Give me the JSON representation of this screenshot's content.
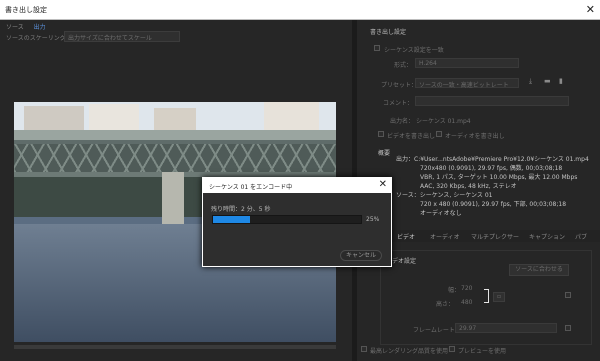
{
  "window": {
    "title": "書き出し設定",
    "close": "✕"
  },
  "left": {
    "tabs": [
      "ソース",
      "出力"
    ],
    "scaling_label": "ソースのスケーリング：",
    "scaling_value": "出力サイズに合わせてスケール"
  },
  "right": {
    "section_title": "書き出し設定",
    "match_sequence": "シーケンス設定を一致",
    "format_label": "形式：",
    "format_value": "H.264",
    "preset_label": "プリセット：",
    "preset_value": "ソースの一致・高速ビットレート",
    "comment_label": "コメント：",
    "output_label": "出力名：",
    "output_value": "シーケンス 01.mp4",
    "export_video": "ビデオを書き出し",
    "export_audio": "オーディオを書き出し",
    "summary_title": "概要",
    "summary": {
      "output_label": "出力：",
      "output_lines": [
        "C:¥User...ntsAdobe¥Premiere Pro¥12.0¥シーケンス 01.mp4",
        "720x480 (0.9091), 29.97 fps, 偶数, 00;03;08;18",
        "VBR, 1 パス, ターゲット 10.00 Mbps, 最大 12.00 Mbps",
        "AAC, 320 Kbps, 48 kHz, ステレオ"
      ],
      "source_label": "ソース：",
      "source_lines": [
        "シーケンス, シーケンス 01",
        "720 x 480 (0.9091), 29.97 fps, 下部, 00;03;08;18",
        "オーディオなし"
      ]
    },
    "tabs": [
      "ビデオ",
      "オーディオ",
      "マルチプレクサー",
      "キャプション",
      "パブ"
    ],
    "video_settings_title": "ビデオ設定",
    "match_source_button": "ソースに合わせる",
    "width_label": "幅：",
    "width_value": "720",
    "height_label": "高さ：",
    "height_value": "480",
    "framerate_label": "フレームレート：",
    "framerate_value": "29.97",
    "max_render": "最高レンダリング品質を使用",
    "use_preview": "プレビューを使用"
  },
  "dialog": {
    "title": "シーケンス 01 をエンコード中",
    "remaining": "残り時間：2 分、5 秒",
    "progress_percent": 25,
    "percent_label": "25%",
    "cancel": "キャンセル"
  },
  "colors": {
    "accent": "#1e88e5",
    "background": "#262626"
  }
}
